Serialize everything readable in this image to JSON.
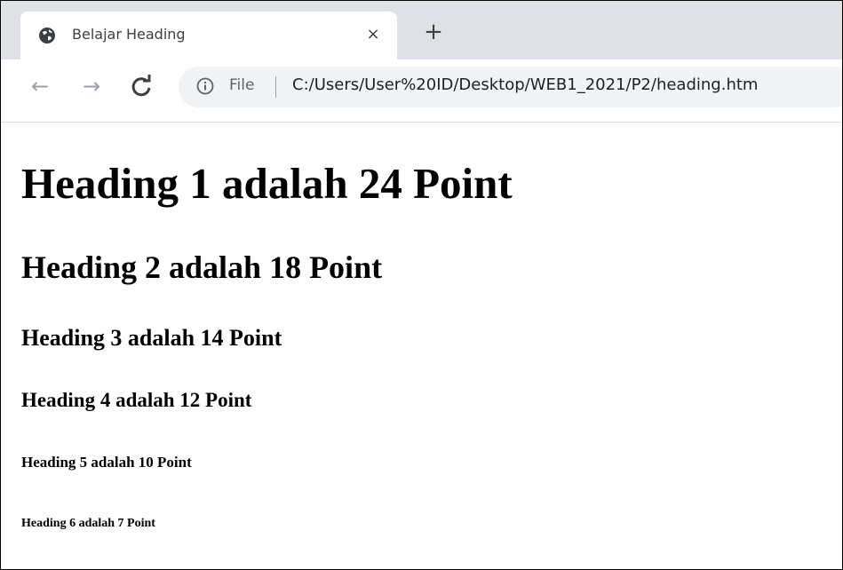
{
  "browser": {
    "tab": {
      "title": "Belajar Heading",
      "favicon": "globe-icon",
      "close_glyph": "×"
    },
    "new_tab_glyph": "+",
    "toolbar": {
      "back_glyph": "←",
      "forward_glyph": "→",
      "reload_glyph": "C",
      "omnibox": {
        "security_icon": "info-icon",
        "scheme_label": "File",
        "url": "C:/Users/User%20ID/Desktop/WEB1_2021/P2/heading.htm"
      }
    }
  },
  "page": {
    "headings": [
      "Heading 1 adalah 24 Point",
      "Heading 2 adalah 18 Point",
      "Heading 3 adalah 14 Point",
      "Heading 4 adalah 12 Point",
      "Heading 5 adalah 10 Point",
      "Heading 6 adalah 7 Point"
    ]
  },
  "colors": {
    "tabstrip_bg": "#dee1e6",
    "omnibox_bg": "#f1f3f4",
    "disabled_nav": "#9aa0a6",
    "text_primary": "#202124"
  }
}
